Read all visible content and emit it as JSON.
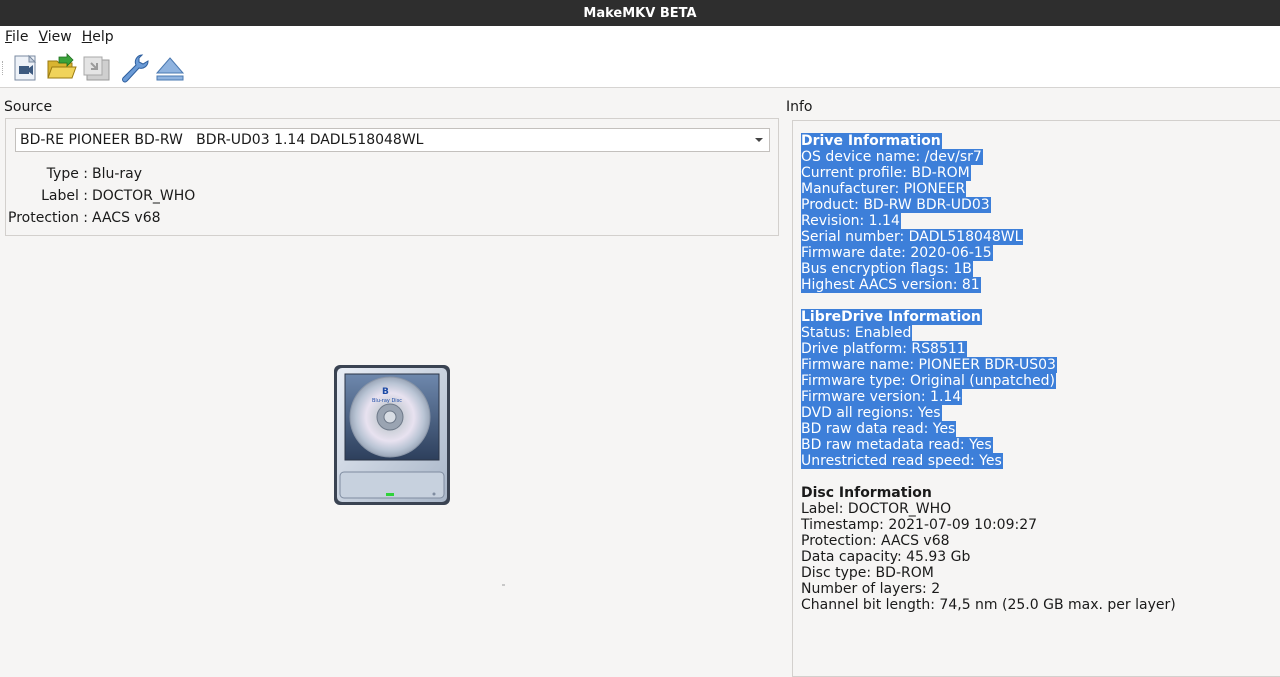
{
  "window": {
    "title": "MakeMKV BETA"
  },
  "menu": {
    "items": [
      "File",
      "View",
      "Help"
    ]
  },
  "toolbar": {
    "buttons": [
      {
        "icon": "open-disc-icon"
      },
      {
        "icon": "open-files-icon"
      },
      {
        "icon": "backup-icon"
      },
      {
        "icon": "preferences-wrench-icon"
      },
      {
        "icon": "eject-icon"
      }
    ]
  },
  "source": {
    "title": "Source",
    "drive_selected": "BD-RE PIONEER BD-RW   BDR-UD03 1.14 DADL518048WL",
    "type_label": "Type :",
    "type_value": "Blu-ray",
    "label_label": "Label :",
    "label_value": "DOCTOR_WHO",
    "protection_label": "Protection :",
    "protection_value": "AACS v68",
    "disc_icon_text": "Blu-ray Disc"
  },
  "info": {
    "title": "Info",
    "drive": {
      "heading": "Drive Information",
      "lines": [
        "OS device name: /dev/sr7",
        "Current profile: BD-ROM",
        "Manufacturer: PIONEER",
        "Product: BD-RW BDR-UD03",
        "Revision: 1.14",
        "Serial number: DADL518048WL",
        "Firmware date: 2020-06-15",
        "Bus encryption flags: 1B",
        "Highest AACS version: 81"
      ]
    },
    "libredrive": {
      "heading": "LibreDrive Information",
      "lines": [
        "Status: Enabled",
        "Drive platform: RS8511",
        "Firmware name: PIONEER BDR-US03",
        "Firmware type: Original (unpatched)",
        "Firmware version: 1.14",
        "DVD all regions: Yes",
        "BD raw data read: Yes",
        "BD raw metadata read: Yes",
        "Unrestricted read speed: Yes"
      ]
    },
    "disc": {
      "heading": "Disc Information",
      "lines": [
        "Label: DOCTOR_WHO",
        "Timestamp: 2021-07-09 10:09:27",
        "Protection: AACS v68",
        "Data capacity: 45.93 Gb",
        "Disc type: BD-ROM",
        "Number of layers: 2",
        "Channel bit length: 74,5 nm (25.0 GB max. per layer)"
      ]
    }
  },
  "colors": {
    "selection": "#3d7fd9",
    "titlebar": "#2e2e2e"
  }
}
